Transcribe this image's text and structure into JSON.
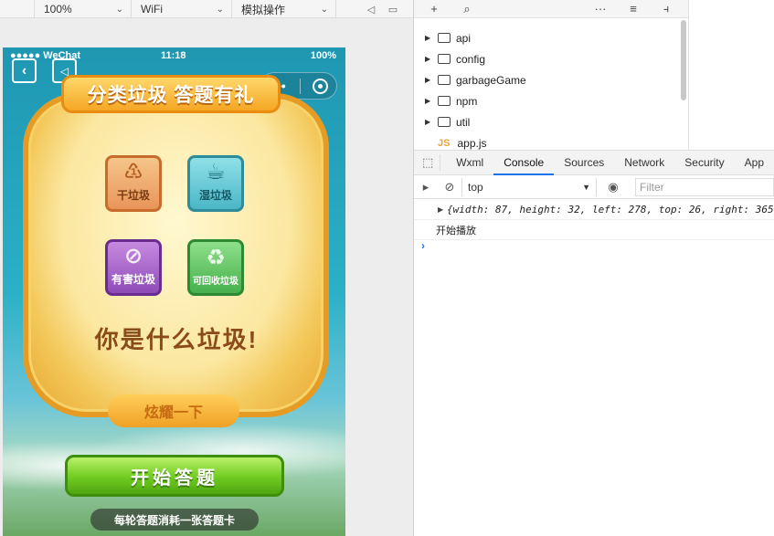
{
  "simulator_toolbar": {
    "zoom": "100%",
    "network": "WiFi",
    "operation": "模拟操作"
  },
  "phone": {
    "status": {
      "carrier": "●●●●● WeChat",
      "time": "11:18",
      "battery": "100%"
    },
    "title_banner": "分类垃圾 答题有礼",
    "tiles": [
      {
        "label": "干垃圾",
        "icon": "dry-waste-icon"
      },
      {
        "label": "湿垃圾",
        "icon": "wet-waste-icon"
      },
      {
        "label": "有害垃圾",
        "icon": "hazardous-waste-icon"
      },
      {
        "label": "可回收垃圾",
        "icon": "recyclable-icon"
      }
    ],
    "question": "你是什么垃圾!",
    "show_button": "炫耀一下",
    "start_button": "开始答题",
    "tip": "每轮答题消耗一张答题卡"
  },
  "file_tree": {
    "items": [
      {
        "name": "api",
        "type": "folder"
      },
      {
        "name": "config",
        "type": "folder"
      },
      {
        "name": "garbageGame",
        "type": "folder"
      },
      {
        "name": "npm",
        "type": "folder"
      },
      {
        "name": "util",
        "type": "folder"
      },
      {
        "name": "app.js",
        "type": "js",
        "badge": "JS"
      }
    ]
  },
  "devtools": {
    "tabs": [
      "Wxml",
      "Console",
      "Sources",
      "Network",
      "Security",
      "App"
    ],
    "active_tab": "Console",
    "context": "top",
    "filter_placeholder": "Filter",
    "logs": [
      {
        "text": "{width: 87, height: 32, left: 278, top: 26, right: 365,"
      },
      {
        "text": "开始播放"
      }
    ],
    "prompt": "›"
  },
  "colors": {
    "accent": "#1a73e8",
    "board": "#f5c04a",
    "start_button": "#6fcb1e"
  }
}
